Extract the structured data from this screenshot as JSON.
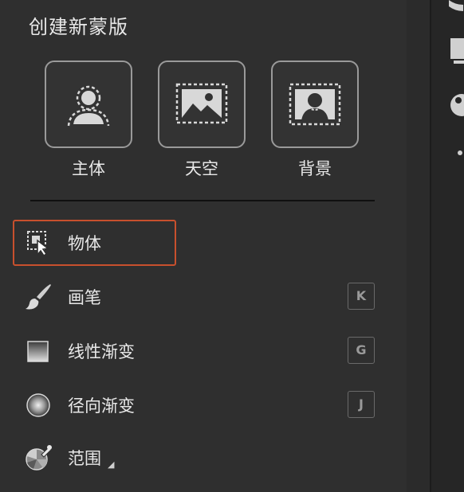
{
  "panel": {
    "title": "创建新蒙版"
  },
  "mask_options": [
    {
      "label": "主体",
      "icon": "subject-icon"
    },
    {
      "label": "天空",
      "icon": "sky-icon"
    },
    {
      "label": "背景",
      "icon": "background-icon"
    }
  ],
  "tools": [
    {
      "label": "物体",
      "icon": "object-select-icon",
      "shortcut": "",
      "selected": true
    },
    {
      "label": "画笔",
      "icon": "brush-icon",
      "shortcut": "K"
    },
    {
      "label": "线性渐变",
      "icon": "linear-gradient-icon",
      "shortcut": "G"
    },
    {
      "label": "径向渐变",
      "icon": "radial-gradient-icon",
      "shortcut": "J"
    },
    {
      "label": "范围",
      "icon": "range-icon",
      "shortcut": "",
      "has_dropdown": true
    }
  ],
  "colors": {
    "selection_border": "#c8502d",
    "panel_background": "#2f2f2f",
    "text": "#e8e8e8"
  }
}
